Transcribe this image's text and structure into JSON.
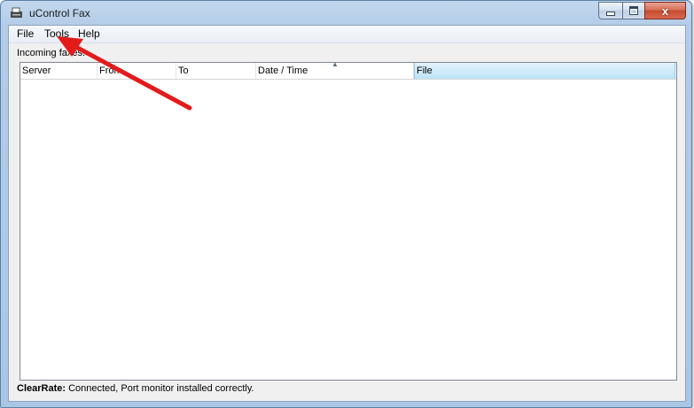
{
  "window": {
    "title": "uControl Fax",
    "minimize_label": "",
    "maximize_label": "",
    "close_label": "x"
  },
  "menu": {
    "items": [
      {
        "label": "File"
      },
      {
        "label": "Tools"
      },
      {
        "label": "Help"
      }
    ]
  },
  "main": {
    "incoming_label": "Incoming faxes:",
    "columns": [
      {
        "label": "Server"
      },
      {
        "label": "From"
      },
      {
        "label": "To"
      },
      {
        "label": "Date / Time"
      },
      {
        "label": "File"
      }
    ],
    "sorted_column": "Date / Time",
    "rows": []
  },
  "status": {
    "product": "ClearRate:",
    "message": " Connected, Port monitor installed correctly."
  },
  "annotation": {
    "arrow_color": "#e31b1b",
    "icon": "red-arrow-pointing-to-tools-menu"
  }
}
